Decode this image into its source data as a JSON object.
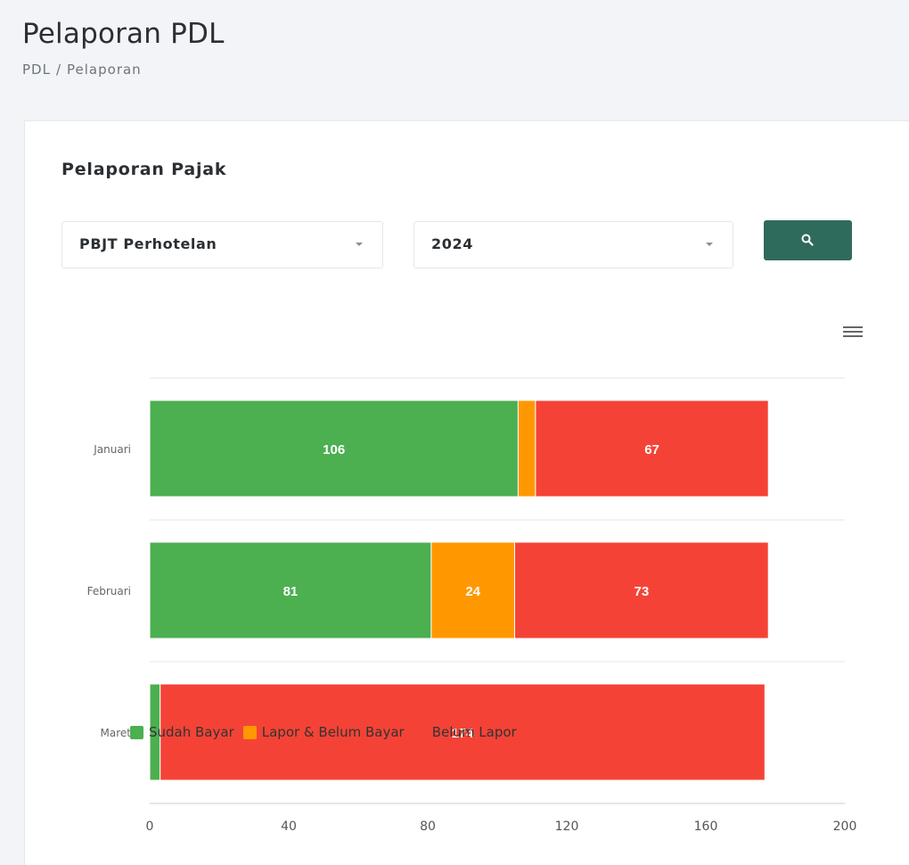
{
  "header": {
    "title": "Pelaporan PDL",
    "breadcrumb": [
      "PDL",
      "Pelaporan"
    ],
    "breadcrumb_separator": "/"
  },
  "card": {
    "title": "Pelaporan Pajak",
    "filters": {
      "tax_type": "PBJT Perhotelan",
      "year": "2024"
    },
    "search_button_icon": "search-icon",
    "chart_menu_icon": "hamburger-menu-icon"
  },
  "chart_data": {
    "type": "bar",
    "orientation": "horizontal",
    "stacked": true,
    "categories": [
      "Januari",
      "Februari",
      "Maret"
    ],
    "series": [
      {
        "name": "Sudah Bayar",
        "color": "#4caf50",
        "values": [
          106,
          81,
          3
        ],
        "labels": [
          "106",
          "81",
          ""
        ]
      },
      {
        "name": "Lapor & Belum Bayar",
        "color": "#ff9800",
        "values": [
          5,
          24,
          0
        ],
        "labels": [
          "",
          "24",
          ""
        ]
      },
      {
        "name": "Belum Lapor",
        "color": "#f44336",
        "values": [
          67,
          73,
          174
        ],
        "labels": [
          "67",
          "73",
          "174"
        ]
      }
    ],
    "xlim": [
      0,
      200
    ],
    "xticks": [
      "0",
      "40",
      "80",
      "120",
      "160",
      "200"
    ],
    "grid": true,
    "legend_position": "bottom-left"
  }
}
